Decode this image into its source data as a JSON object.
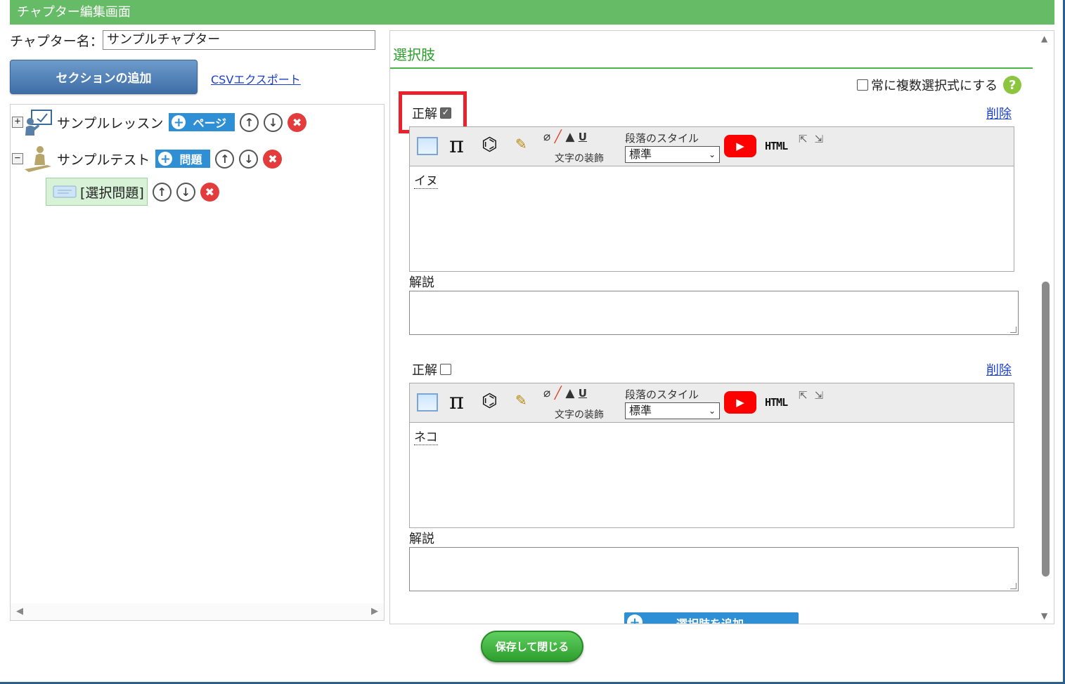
{
  "window": {
    "title": "チャプター編集画面"
  },
  "left": {
    "chapter_name_label": "チャプター名：",
    "chapter_name_value": "サンプルチャプター",
    "add_section_label": "セクションの追加",
    "csv_export_label": "CSVエクスポート",
    "tree": {
      "lesson": {
        "expander": "+",
        "label": "サンプルレッスン",
        "add_label": "ページ"
      },
      "test": {
        "expander": "−",
        "label": "サンプルテスト",
        "add_label": "問題"
      },
      "question": {
        "label": "[選択問題]"
      }
    },
    "icons": {
      "up": "↑",
      "down": "↓",
      "delete": "✖",
      "plus": "+",
      "scroll_left": "◀",
      "scroll_right": "▶"
    }
  },
  "right": {
    "section_title": "選択肢",
    "multi_select_label": "常に複数選択式にする",
    "help_glyph": "?",
    "toolbar": {
      "pi": "π",
      "eraser": "⌬",
      "brush": "✎",
      "format_icons": "⌀",
      "format_u": "U",
      "format_label": "文字の装飾",
      "paragraph_label": "段落のスタイル",
      "paragraph_value": "標準",
      "caret": "⌄",
      "play": "▶",
      "html_label": "HTML",
      "expand": "⇱⇲"
    },
    "choices": [
      {
        "correct_label": "正解",
        "checked": true,
        "delete_label": "削除",
        "content": "イヌ",
        "explanation_label": "解説"
      },
      {
        "correct_label": "正解",
        "checked": false,
        "delete_label": "削除",
        "content": "ネコ",
        "explanation_label": "解説"
      }
    ],
    "add_choice_label": "選択肢を追加",
    "scroll_up": "▲",
    "scroll_down": "▼"
  },
  "footer": {
    "save_close_label": "保存して閉じる"
  },
  "colors": {
    "title_bar": "#66bb66",
    "accent_green": "#2aa02a",
    "blue_button": "#2f8fd4",
    "highlight_red": "#e8232e",
    "link_blue": "#1a3fcc"
  }
}
